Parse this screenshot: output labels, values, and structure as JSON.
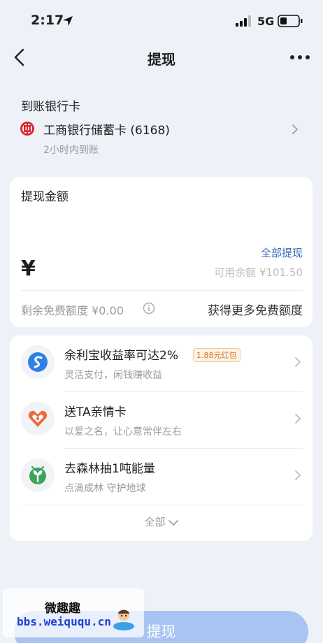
{
  "status_bar": {
    "time": "2:17",
    "network": "5G"
  },
  "header": {
    "title": "提现",
    "back_icon": "chevron-left-icon",
    "more_icon": "more-dots-icon"
  },
  "bank": {
    "heading": "到账银行卡",
    "name": "工商银行储蓄卡 (6168)",
    "arrival": "2小时内到账",
    "logo_color": "#d7282f"
  },
  "amount": {
    "label": "提现金额",
    "currency_symbol": "¥",
    "value": "",
    "withdraw_all": "全部提现",
    "available": "可用余额 ¥101.50",
    "free_quota": "剩余免费额度 ¥0.00",
    "get_more": "获得更多免费额度"
  },
  "promos": [
    {
      "title": "余利宝收益率可达2%",
      "badge": "1.88元红包",
      "subtitle": "灵活支付，闲钱赚收益",
      "icon": "yulibao-icon"
    },
    {
      "title": "送TA亲情卡",
      "subtitle": "以爱之名，让心意常伴左右",
      "icon": "heart-card-icon"
    },
    {
      "title": "去森林抽1吨能量",
      "subtitle": "点滴成林 守护地球",
      "icon": "forest-sprout-icon"
    }
  ],
  "show_all": "全部",
  "submit": "提现",
  "watermark": {
    "title": "微趣趣",
    "url": "bbs.weiququ.cn"
  },
  "colors": {
    "accent": "#3a6ab8",
    "background": "#eef1f8",
    "submit_disabled": "#a9c4f2",
    "badge": "#d0762a"
  }
}
